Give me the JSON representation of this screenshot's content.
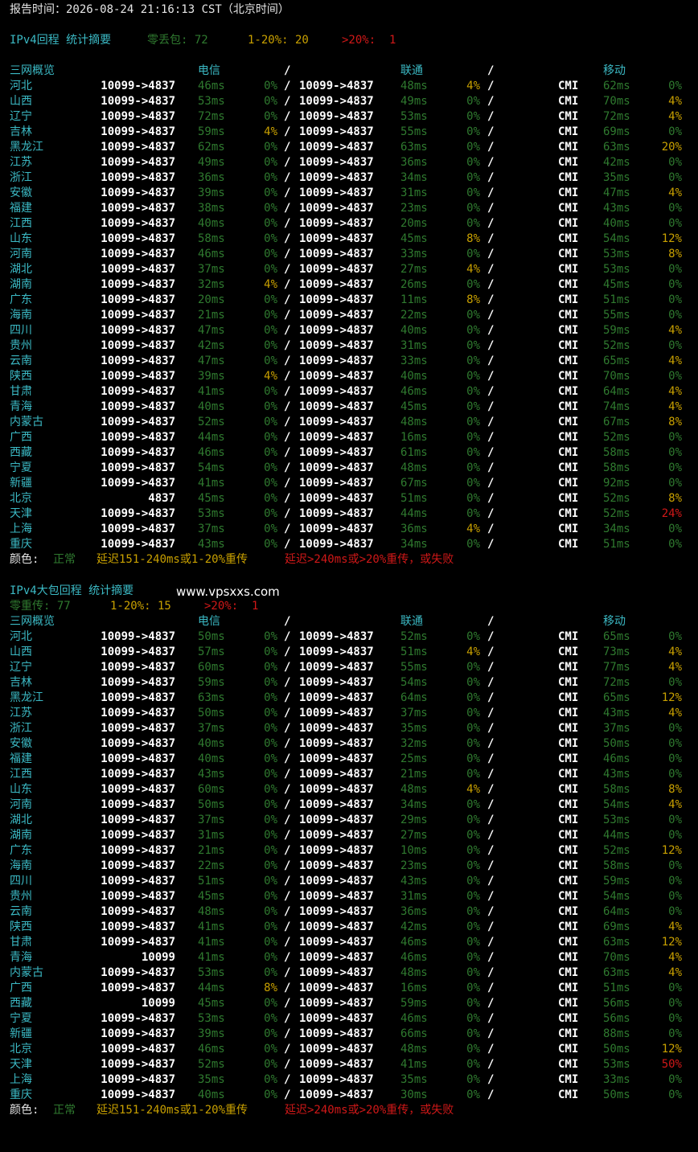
{
  "report_time": "报告时间：2026-08-24 21:16:13 CST（北京时间）",
  "colors": {
    "normal": "#2f7a2f",
    "warn": "#c8a000",
    "bad": "#d01818",
    "title": "#3bb9c4",
    "text": "#e6e6e6"
  },
  "legend": {
    "label": "颜色:",
    "normal": "正常",
    "warn": "延迟151-240ms或1-20%重传",
    "bad": "延迟>240ms或>20%重传，或失败"
  },
  "header": {
    "overview": "三网概览",
    "ct": "电信",
    "sep": "/",
    "cu": "联通",
    "cm": "移动"
  },
  "sections": [
    {
      "title": "IPv4回程 统计摘要",
      "watermark": "",
      "summary": {
        "zero_label": "零丢包: 72",
        "mid_label": "1-20%: 20",
        "high_label": ">20%:  1"
      },
      "rows": [
        {
          "p": "河北",
          "ct_route": "10099->4837",
          "ct_ms": "46ms",
          "ct_loss": "0%",
          "cu_route": "10099->4837",
          "cu_ms": "48ms",
          "cu_loss": "4%",
          "cm_route": "CMI",
          "cm_ms": "62ms",
          "cm_loss": "0%"
        },
        {
          "p": "山西",
          "ct_route": "10099->4837",
          "ct_ms": "53ms",
          "ct_loss": "0%",
          "cu_route": "10099->4837",
          "cu_ms": "49ms",
          "cu_loss": "0%",
          "cm_route": "CMI",
          "cm_ms": "70ms",
          "cm_loss": "4%"
        },
        {
          "p": "辽宁",
          "ct_route": "10099->4837",
          "ct_ms": "72ms",
          "ct_loss": "0%",
          "cu_route": "10099->4837",
          "cu_ms": "53ms",
          "cu_loss": "0%",
          "cm_route": "CMI",
          "cm_ms": "72ms",
          "cm_loss": "4%"
        },
        {
          "p": "吉林",
          "ct_route": "10099->4837",
          "ct_ms": "59ms",
          "ct_loss": "4%",
          "cu_route": "10099->4837",
          "cu_ms": "55ms",
          "cu_loss": "0%",
          "cm_route": "CMI",
          "cm_ms": "69ms",
          "cm_loss": "0%"
        },
        {
          "p": "黑龙江",
          "ct_route": "10099->4837",
          "ct_ms": "62ms",
          "ct_loss": "0%",
          "cu_route": "10099->4837",
          "cu_ms": "63ms",
          "cu_loss": "0%",
          "cm_route": "CMI",
          "cm_ms": "63ms",
          "cm_loss": "20%"
        },
        {
          "p": "江苏",
          "ct_route": "10099->4837",
          "ct_ms": "49ms",
          "ct_loss": "0%",
          "cu_route": "10099->4837",
          "cu_ms": "36ms",
          "cu_loss": "0%",
          "cm_route": "CMI",
          "cm_ms": "42ms",
          "cm_loss": "0%"
        },
        {
          "p": "浙江",
          "ct_route": "10099->4837",
          "ct_ms": "36ms",
          "ct_loss": "0%",
          "cu_route": "10099->4837",
          "cu_ms": "34ms",
          "cu_loss": "0%",
          "cm_route": "CMI",
          "cm_ms": "35ms",
          "cm_loss": "0%"
        },
        {
          "p": "安徽",
          "ct_route": "10099->4837",
          "ct_ms": "39ms",
          "ct_loss": "0%",
          "cu_route": "10099->4837",
          "cu_ms": "31ms",
          "cu_loss": "0%",
          "cm_route": "CMI",
          "cm_ms": "47ms",
          "cm_loss": "4%"
        },
        {
          "p": "福建",
          "ct_route": "10099->4837",
          "ct_ms": "38ms",
          "ct_loss": "0%",
          "cu_route": "10099->4837",
          "cu_ms": "23ms",
          "cu_loss": "0%",
          "cm_route": "CMI",
          "cm_ms": "43ms",
          "cm_loss": "0%"
        },
        {
          "p": "江西",
          "ct_route": "10099->4837",
          "ct_ms": "40ms",
          "ct_loss": "0%",
          "cu_route": "10099->4837",
          "cu_ms": "20ms",
          "cu_loss": "0%",
          "cm_route": "CMI",
          "cm_ms": "40ms",
          "cm_loss": "0%"
        },
        {
          "p": "山东",
          "ct_route": "10099->4837",
          "ct_ms": "58ms",
          "ct_loss": "0%",
          "cu_route": "10099->4837",
          "cu_ms": "45ms",
          "cu_loss": "8%",
          "cm_route": "CMI",
          "cm_ms": "54ms",
          "cm_loss": "12%"
        },
        {
          "p": "河南",
          "ct_route": "10099->4837",
          "ct_ms": "46ms",
          "ct_loss": "0%",
          "cu_route": "10099->4837",
          "cu_ms": "33ms",
          "cu_loss": "0%",
          "cm_route": "CMI",
          "cm_ms": "53ms",
          "cm_loss": "8%"
        },
        {
          "p": "湖北",
          "ct_route": "10099->4837",
          "ct_ms": "37ms",
          "ct_loss": "0%",
          "cu_route": "10099->4837",
          "cu_ms": "27ms",
          "cu_loss": "4%",
          "cm_route": "CMI",
          "cm_ms": "53ms",
          "cm_loss": "0%"
        },
        {
          "p": "湖南",
          "ct_route": "10099->4837",
          "ct_ms": "32ms",
          "ct_loss": "4%",
          "cu_route": "10099->4837",
          "cu_ms": "26ms",
          "cu_loss": "0%",
          "cm_route": "CMI",
          "cm_ms": "45ms",
          "cm_loss": "0%"
        },
        {
          "p": "广东",
          "ct_route": "10099->4837",
          "ct_ms": "20ms",
          "ct_loss": "0%",
          "cu_route": "10099->4837",
          "cu_ms": "11ms",
          "cu_loss": "8%",
          "cm_route": "CMI",
          "cm_ms": "51ms",
          "cm_loss": "0%"
        },
        {
          "p": "海南",
          "ct_route": "10099->4837",
          "ct_ms": "21ms",
          "ct_loss": "0%",
          "cu_route": "10099->4837",
          "cu_ms": "22ms",
          "cu_loss": "0%",
          "cm_route": "CMI",
          "cm_ms": "55ms",
          "cm_loss": "0%"
        },
        {
          "p": "四川",
          "ct_route": "10099->4837",
          "ct_ms": "47ms",
          "ct_loss": "0%",
          "cu_route": "10099->4837",
          "cu_ms": "40ms",
          "cu_loss": "0%",
          "cm_route": "CMI",
          "cm_ms": "59ms",
          "cm_loss": "4%"
        },
        {
          "p": "贵州",
          "ct_route": "10099->4837",
          "ct_ms": "42ms",
          "ct_loss": "0%",
          "cu_route": "10099->4837",
          "cu_ms": "31ms",
          "cu_loss": "0%",
          "cm_route": "CMI",
          "cm_ms": "52ms",
          "cm_loss": "0%"
        },
        {
          "p": "云南",
          "ct_route": "10099->4837",
          "ct_ms": "47ms",
          "ct_loss": "0%",
          "cu_route": "10099->4837",
          "cu_ms": "33ms",
          "cu_loss": "0%",
          "cm_route": "CMI",
          "cm_ms": "65ms",
          "cm_loss": "4%"
        },
        {
          "p": "陕西",
          "ct_route": "10099->4837",
          "ct_ms": "39ms",
          "ct_loss": "4%",
          "cu_route": "10099->4837",
          "cu_ms": "40ms",
          "cu_loss": "0%",
          "cm_route": "CMI",
          "cm_ms": "70ms",
          "cm_loss": "0%"
        },
        {
          "p": "甘肃",
          "ct_route": "10099->4837",
          "ct_ms": "41ms",
          "ct_loss": "0%",
          "cu_route": "10099->4837",
          "cu_ms": "46ms",
          "cu_loss": "0%",
          "cm_route": "CMI",
          "cm_ms": "64ms",
          "cm_loss": "4%"
        },
        {
          "p": "青海",
          "ct_route": "10099->4837",
          "ct_ms": "40ms",
          "ct_loss": "0%",
          "cu_route": "10099->4837",
          "cu_ms": "45ms",
          "cu_loss": "0%",
          "cm_route": "CMI",
          "cm_ms": "74ms",
          "cm_loss": "4%"
        },
        {
          "p": "内蒙古",
          "ct_route": "10099->4837",
          "ct_ms": "52ms",
          "ct_loss": "0%",
          "cu_route": "10099->4837",
          "cu_ms": "48ms",
          "cu_loss": "0%",
          "cm_route": "CMI",
          "cm_ms": "67ms",
          "cm_loss": "8%"
        },
        {
          "p": "广西",
          "ct_route": "10099->4837",
          "ct_ms": "44ms",
          "ct_loss": "0%",
          "cu_route": "10099->4837",
          "cu_ms": "16ms",
          "cu_loss": "0%",
          "cm_route": "CMI",
          "cm_ms": "52ms",
          "cm_loss": "0%"
        },
        {
          "p": "西藏",
          "ct_route": "10099->4837",
          "ct_ms": "46ms",
          "ct_loss": "0%",
          "cu_route": "10099->4837",
          "cu_ms": "61ms",
          "cu_loss": "0%",
          "cm_route": "CMI",
          "cm_ms": "58ms",
          "cm_loss": "0%"
        },
        {
          "p": "宁夏",
          "ct_route": "10099->4837",
          "ct_ms": "54ms",
          "ct_loss": "0%",
          "cu_route": "10099->4837",
          "cu_ms": "48ms",
          "cu_loss": "0%",
          "cm_route": "CMI",
          "cm_ms": "58ms",
          "cm_loss": "0%"
        },
        {
          "p": "新疆",
          "ct_route": "10099->4837",
          "ct_ms": "41ms",
          "ct_loss": "0%",
          "cu_route": "10099->4837",
          "cu_ms": "67ms",
          "cu_loss": "0%",
          "cm_route": "CMI",
          "cm_ms": "92ms",
          "cm_loss": "0%"
        },
        {
          "p": "北京",
          "ct_route": "4837",
          "ct_ms": "45ms",
          "ct_loss": "0%",
          "cu_route": "10099->4837",
          "cu_ms": "51ms",
          "cu_loss": "0%",
          "cm_route": "CMI",
          "cm_ms": "52ms",
          "cm_loss": "8%"
        },
        {
          "p": "天津",
          "ct_route": "10099->4837",
          "ct_ms": "53ms",
          "ct_loss": "0%",
          "cu_route": "10099->4837",
          "cu_ms": "44ms",
          "cu_loss": "0%",
          "cm_route": "CMI",
          "cm_ms": "52ms",
          "cm_loss": "24%"
        },
        {
          "p": "上海",
          "ct_route": "10099->4837",
          "ct_ms": "37ms",
          "ct_loss": "0%",
          "cu_route": "10099->4837",
          "cu_ms": "36ms",
          "cu_loss": "4%",
          "cm_route": "CMI",
          "cm_ms": "34ms",
          "cm_loss": "0%"
        },
        {
          "p": "重庆",
          "ct_route": "10099->4837",
          "ct_ms": "43ms",
          "ct_loss": "0%",
          "cu_route": "10099->4837",
          "cu_ms": "34ms",
          "cu_loss": "0%",
          "cm_route": "CMI",
          "cm_ms": "51ms",
          "cm_loss": "0%"
        }
      ]
    },
    {
      "title": "IPv4大包回程 统计摘要",
      "watermark": "www.vpsxxs.com",
      "summary": {
        "zero_label": "零重传: 77",
        "mid_label": "1-20%: 15",
        "high_label": ">20%:  1"
      },
      "rows": [
        {
          "p": "河北",
          "ct_route": "10099->4837",
          "ct_ms": "50ms",
          "ct_loss": "0%",
          "cu_route": "10099->4837",
          "cu_ms": "52ms",
          "cu_loss": "0%",
          "cm_route": "CMI",
          "cm_ms": "65ms",
          "cm_loss": "0%"
        },
        {
          "p": "山西",
          "ct_route": "10099->4837",
          "ct_ms": "57ms",
          "ct_loss": "0%",
          "cu_route": "10099->4837",
          "cu_ms": "51ms",
          "cu_loss": "4%",
          "cm_route": "CMI",
          "cm_ms": "73ms",
          "cm_loss": "4%"
        },
        {
          "p": "辽宁",
          "ct_route": "10099->4837",
          "ct_ms": "60ms",
          "ct_loss": "0%",
          "cu_route": "10099->4837",
          "cu_ms": "55ms",
          "cu_loss": "0%",
          "cm_route": "CMI",
          "cm_ms": "77ms",
          "cm_loss": "4%"
        },
        {
          "p": "吉林",
          "ct_route": "10099->4837",
          "ct_ms": "59ms",
          "ct_loss": "0%",
          "cu_route": "10099->4837",
          "cu_ms": "54ms",
          "cu_loss": "0%",
          "cm_route": "CMI",
          "cm_ms": "72ms",
          "cm_loss": "0%"
        },
        {
          "p": "黑龙江",
          "ct_route": "10099->4837",
          "ct_ms": "63ms",
          "ct_loss": "0%",
          "cu_route": "10099->4837",
          "cu_ms": "64ms",
          "cu_loss": "0%",
          "cm_route": "CMI",
          "cm_ms": "65ms",
          "cm_loss": "12%"
        },
        {
          "p": "江苏",
          "ct_route": "10099->4837",
          "ct_ms": "50ms",
          "ct_loss": "0%",
          "cu_route": "10099->4837",
          "cu_ms": "37ms",
          "cu_loss": "0%",
          "cm_route": "CMI",
          "cm_ms": "43ms",
          "cm_loss": "4%"
        },
        {
          "p": "浙江",
          "ct_route": "10099->4837",
          "ct_ms": "37ms",
          "ct_loss": "0%",
          "cu_route": "10099->4837",
          "cu_ms": "35ms",
          "cu_loss": "0%",
          "cm_route": "CMI",
          "cm_ms": "37ms",
          "cm_loss": "0%"
        },
        {
          "p": "安徽",
          "ct_route": "10099->4837",
          "ct_ms": "40ms",
          "ct_loss": "0%",
          "cu_route": "10099->4837",
          "cu_ms": "32ms",
          "cu_loss": "0%",
          "cm_route": "CMI",
          "cm_ms": "50ms",
          "cm_loss": "0%"
        },
        {
          "p": "福建",
          "ct_route": "10099->4837",
          "ct_ms": "40ms",
          "ct_loss": "0%",
          "cu_route": "10099->4837",
          "cu_ms": "25ms",
          "cu_loss": "0%",
          "cm_route": "CMI",
          "cm_ms": "46ms",
          "cm_loss": "0%"
        },
        {
          "p": "江西",
          "ct_route": "10099->4837",
          "ct_ms": "43ms",
          "ct_loss": "0%",
          "cu_route": "10099->4837",
          "cu_ms": "21ms",
          "cu_loss": "0%",
          "cm_route": "CMI",
          "cm_ms": "43ms",
          "cm_loss": "0%"
        },
        {
          "p": "山东",
          "ct_route": "10099->4837",
          "ct_ms": "60ms",
          "ct_loss": "0%",
          "cu_route": "10099->4837",
          "cu_ms": "48ms",
          "cu_loss": "4%",
          "cm_route": "CMI",
          "cm_ms": "58ms",
          "cm_loss": "8%"
        },
        {
          "p": "河南",
          "ct_route": "10099->4837",
          "ct_ms": "50ms",
          "ct_loss": "0%",
          "cu_route": "10099->4837",
          "cu_ms": "34ms",
          "cu_loss": "0%",
          "cm_route": "CMI",
          "cm_ms": "54ms",
          "cm_loss": "4%"
        },
        {
          "p": "湖北",
          "ct_route": "10099->4837",
          "ct_ms": "37ms",
          "ct_loss": "0%",
          "cu_route": "10099->4837",
          "cu_ms": "29ms",
          "cu_loss": "0%",
          "cm_route": "CMI",
          "cm_ms": "53ms",
          "cm_loss": "0%"
        },
        {
          "p": "湖南",
          "ct_route": "10099->4837",
          "ct_ms": "31ms",
          "ct_loss": "0%",
          "cu_route": "10099->4837",
          "cu_ms": "27ms",
          "cu_loss": "0%",
          "cm_route": "CMI",
          "cm_ms": "44ms",
          "cm_loss": "0%"
        },
        {
          "p": "广东",
          "ct_route": "10099->4837",
          "ct_ms": "21ms",
          "ct_loss": "0%",
          "cu_route": "10099->4837",
          "cu_ms": "10ms",
          "cu_loss": "0%",
          "cm_route": "CMI",
          "cm_ms": "52ms",
          "cm_loss": "12%"
        },
        {
          "p": "海南",
          "ct_route": "10099->4837",
          "ct_ms": "22ms",
          "ct_loss": "0%",
          "cu_route": "10099->4837",
          "cu_ms": "23ms",
          "cu_loss": "0%",
          "cm_route": "CMI",
          "cm_ms": "58ms",
          "cm_loss": "0%"
        },
        {
          "p": "四川",
          "ct_route": "10099->4837",
          "ct_ms": "51ms",
          "ct_loss": "0%",
          "cu_route": "10099->4837",
          "cu_ms": "43ms",
          "cu_loss": "0%",
          "cm_route": "CMI",
          "cm_ms": "59ms",
          "cm_loss": "0%"
        },
        {
          "p": "贵州",
          "ct_route": "10099->4837",
          "ct_ms": "45ms",
          "ct_loss": "0%",
          "cu_route": "10099->4837",
          "cu_ms": "31ms",
          "cu_loss": "0%",
          "cm_route": "CMI",
          "cm_ms": "54ms",
          "cm_loss": "0%"
        },
        {
          "p": "云南",
          "ct_route": "10099->4837",
          "ct_ms": "48ms",
          "ct_loss": "0%",
          "cu_route": "10099->4837",
          "cu_ms": "36ms",
          "cu_loss": "0%",
          "cm_route": "CMI",
          "cm_ms": "64ms",
          "cm_loss": "0%"
        },
        {
          "p": "陕西",
          "ct_route": "10099->4837",
          "ct_ms": "41ms",
          "ct_loss": "0%",
          "cu_route": "10099->4837",
          "cu_ms": "42ms",
          "cu_loss": "0%",
          "cm_route": "CMI",
          "cm_ms": "69ms",
          "cm_loss": "4%"
        },
        {
          "p": "甘肃",
          "ct_route": "10099->4837",
          "ct_ms": "41ms",
          "ct_loss": "0%",
          "cu_route": "10099->4837",
          "cu_ms": "46ms",
          "cu_loss": "0%",
          "cm_route": "CMI",
          "cm_ms": "63ms",
          "cm_loss": "12%"
        },
        {
          "p": "青海",
          "ct_route": "10099",
          "ct_ms": "41ms",
          "ct_loss": "0%",
          "cu_route": "10099->4837",
          "cu_ms": "46ms",
          "cu_loss": "0%",
          "cm_route": "CMI",
          "cm_ms": "70ms",
          "cm_loss": "4%"
        },
        {
          "p": "内蒙古",
          "ct_route": "10099->4837",
          "ct_ms": "53ms",
          "ct_loss": "0%",
          "cu_route": "10099->4837",
          "cu_ms": "48ms",
          "cu_loss": "0%",
          "cm_route": "CMI",
          "cm_ms": "63ms",
          "cm_loss": "4%"
        },
        {
          "p": "广西",
          "ct_route": "10099->4837",
          "ct_ms": "44ms",
          "ct_loss": "8%",
          "cu_route": "10099->4837",
          "cu_ms": "16ms",
          "cu_loss": "0%",
          "cm_route": "CMI",
          "cm_ms": "51ms",
          "cm_loss": "0%"
        },
        {
          "p": "西藏",
          "ct_route": "10099",
          "ct_ms": "45ms",
          "ct_loss": "0%",
          "cu_route": "10099->4837",
          "cu_ms": "59ms",
          "cu_loss": "0%",
          "cm_route": "CMI",
          "cm_ms": "56ms",
          "cm_loss": "0%"
        },
        {
          "p": "宁夏",
          "ct_route": "10099->4837",
          "ct_ms": "53ms",
          "ct_loss": "0%",
          "cu_route": "10099->4837",
          "cu_ms": "46ms",
          "cu_loss": "0%",
          "cm_route": "CMI",
          "cm_ms": "56ms",
          "cm_loss": "0%"
        },
        {
          "p": "新疆",
          "ct_route": "10099->4837",
          "ct_ms": "39ms",
          "ct_loss": "0%",
          "cu_route": "10099->4837",
          "cu_ms": "66ms",
          "cu_loss": "0%",
          "cm_route": "CMI",
          "cm_ms": "88ms",
          "cm_loss": "0%"
        },
        {
          "p": "北京",
          "ct_route": "10099->4837",
          "ct_ms": "46ms",
          "ct_loss": "0%",
          "cu_route": "10099->4837",
          "cu_ms": "48ms",
          "cu_loss": "0%",
          "cm_route": "CMI",
          "cm_ms": "50ms",
          "cm_loss": "12%"
        },
        {
          "p": "天津",
          "ct_route": "10099->4837",
          "ct_ms": "52ms",
          "ct_loss": "0%",
          "cu_route": "10099->4837",
          "cu_ms": "41ms",
          "cu_loss": "0%",
          "cm_route": "CMI",
          "cm_ms": "53ms",
          "cm_loss": "50%"
        },
        {
          "p": "上海",
          "ct_route": "10099->4837",
          "ct_ms": "35ms",
          "ct_loss": "0%",
          "cu_route": "10099->4837",
          "cu_ms": "35ms",
          "cu_loss": "0%",
          "cm_route": "CMI",
          "cm_ms": "33ms",
          "cm_loss": "0%"
        },
        {
          "p": "重庆",
          "ct_route": "10099->4837",
          "ct_ms": "40ms",
          "ct_loss": "0%",
          "cu_route": "10099->4837",
          "cu_ms": "30ms",
          "cu_loss": "0%",
          "cm_route": "CMI",
          "cm_ms": "50ms",
          "cm_loss": "0%"
        }
      ]
    }
  ]
}
